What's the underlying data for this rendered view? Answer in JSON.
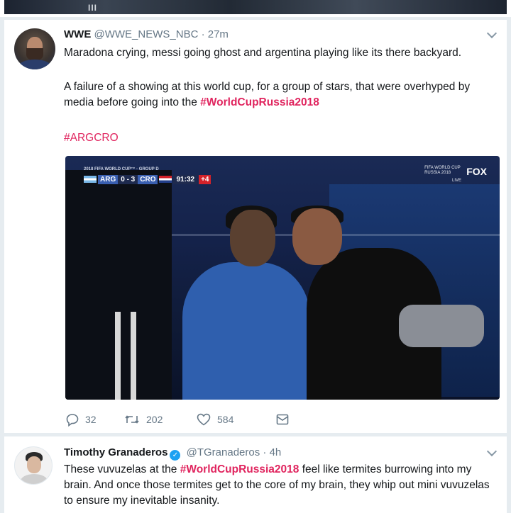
{
  "top_strip": {
    "mark": "III"
  },
  "tweets": [
    {
      "name": "WWE",
      "handle": "@WWE_NEWS_NBC",
      "separator": "·",
      "time": "27m",
      "paragraph1": "Maradona crying, messi going ghost and argentina playing like its there backyard.",
      "paragraph2_text": "A failure of a showing at this world cup, for a group of stars, that were overhyped by media before going into the ",
      "paragraph2_hashtag": "#WorldCupRussia2018",
      "hashtag2": "#ARGCRO",
      "media": {
        "tag": "2018 FIFA WORLD CUP™ · GROUP D",
        "team1": "ARG",
        "score": "0 - 3",
        "team2": "CRO",
        "clock": "91:32",
        "added": "+4",
        "wc_line1": "FIFA WORLD CUP",
        "wc_line2": "RUSSIA 2018",
        "broadcaster": "FOX",
        "live": "LIVE"
      },
      "actions": {
        "replies": "32",
        "retweets": "202",
        "likes": "584"
      }
    },
    {
      "name": "Timothy Granaderos",
      "verified_icon": "✓",
      "handle": "@TGranaderos",
      "separator": "·",
      "time": "4h",
      "text_before": "These vuvuzelas at the ",
      "hashtag": "#WorldCupRussia2018",
      "text_after": " feel like termites burrowing into my brain. And once those termites get to the core of my brain, they whip out mini vuvuzelas to ensure my inevitable insanity."
    }
  ],
  "colors": {
    "accent": "#e0245e",
    "verified": "#1da1f2",
    "muted": "#657786",
    "background": "#e6ecf0"
  },
  "icons": [
    "reply-icon",
    "retweet-icon",
    "like-icon",
    "direct-message-icon",
    "chevron-down-icon",
    "verified-badge-icon"
  ]
}
